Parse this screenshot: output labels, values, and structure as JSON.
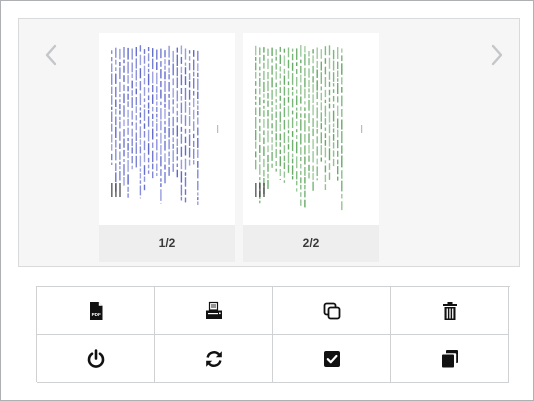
{
  "colors": {
    "frame_border": "#aeb0b3",
    "viewer_background": "#f6f6f7",
    "arrow": "#c4c6c9",
    "icon": "#111111",
    "page1_text": "#5560c8",
    "page2_text": "#5aa55a",
    "page_label_text": "#3a3a3a"
  },
  "viewer": {
    "prev_icon": "chevron-left-icon",
    "next_icon": "chevron-right-icon",
    "pages": [
      {
        "label": "1/2",
        "text_tint": "blue"
      },
      {
        "label": "2/2",
        "text_tint": "green"
      }
    ]
  },
  "toolbar": {
    "rows": [
      [
        "pdf-file-icon",
        "print-icon",
        "copy-icon",
        "trash-icon"
      ],
      [
        "power-icon",
        "refresh-icon",
        "check-square-icon",
        "duplicate-stack-icon"
      ]
    ],
    "pdf_icon_text": "PDF"
  }
}
